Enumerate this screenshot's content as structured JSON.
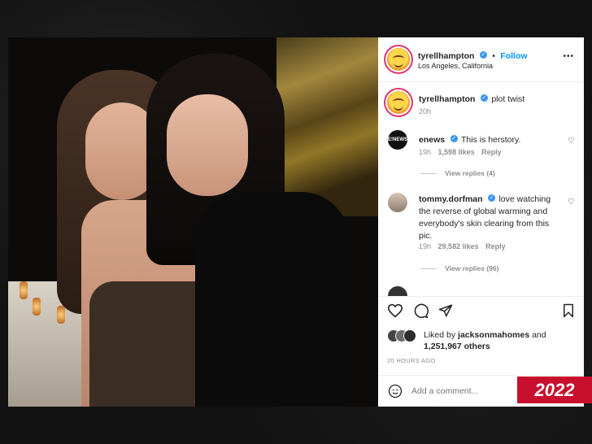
{
  "post": {
    "author": "tyrellhampton",
    "follow_label": "Follow",
    "location": "Los Angeles, California",
    "more_label": "•••",
    "caption": "plot twist",
    "caption_time": "20h"
  },
  "comments": [
    {
      "user": "enews",
      "text": "This is herstory.",
      "time": "19h",
      "likes": "1,598 likes",
      "reply": "Reply",
      "view_replies": "View replies (4)"
    },
    {
      "user": "tommy.dorfman",
      "text": "love watching the reverse of global warming and everybody's skin clearing from this pic.",
      "time": "19h",
      "likes": "29,582 likes",
      "reply": "Reply",
      "view_replies": "View replies (96)"
    }
  ],
  "liked_by": {
    "prefix": "Liked by",
    "user": "jacksonmahomes",
    "suffix": "and",
    "others": "1,251,967 others"
  },
  "timestamp": "20 HOURS AGO",
  "comment_input": {
    "placeholder": "Add a comment..."
  },
  "icons": [
    "heart-icon",
    "comment-icon",
    "share-icon",
    "bookmark-icon",
    "emoji-icon",
    "verified-icon",
    "more-icon"
  ],
  "badge_year": "2022",
  "colors": {
    "badge": "#c8102e",
    "follow": "#0095f6",
    "verified": "#3897f0"
  }
}
